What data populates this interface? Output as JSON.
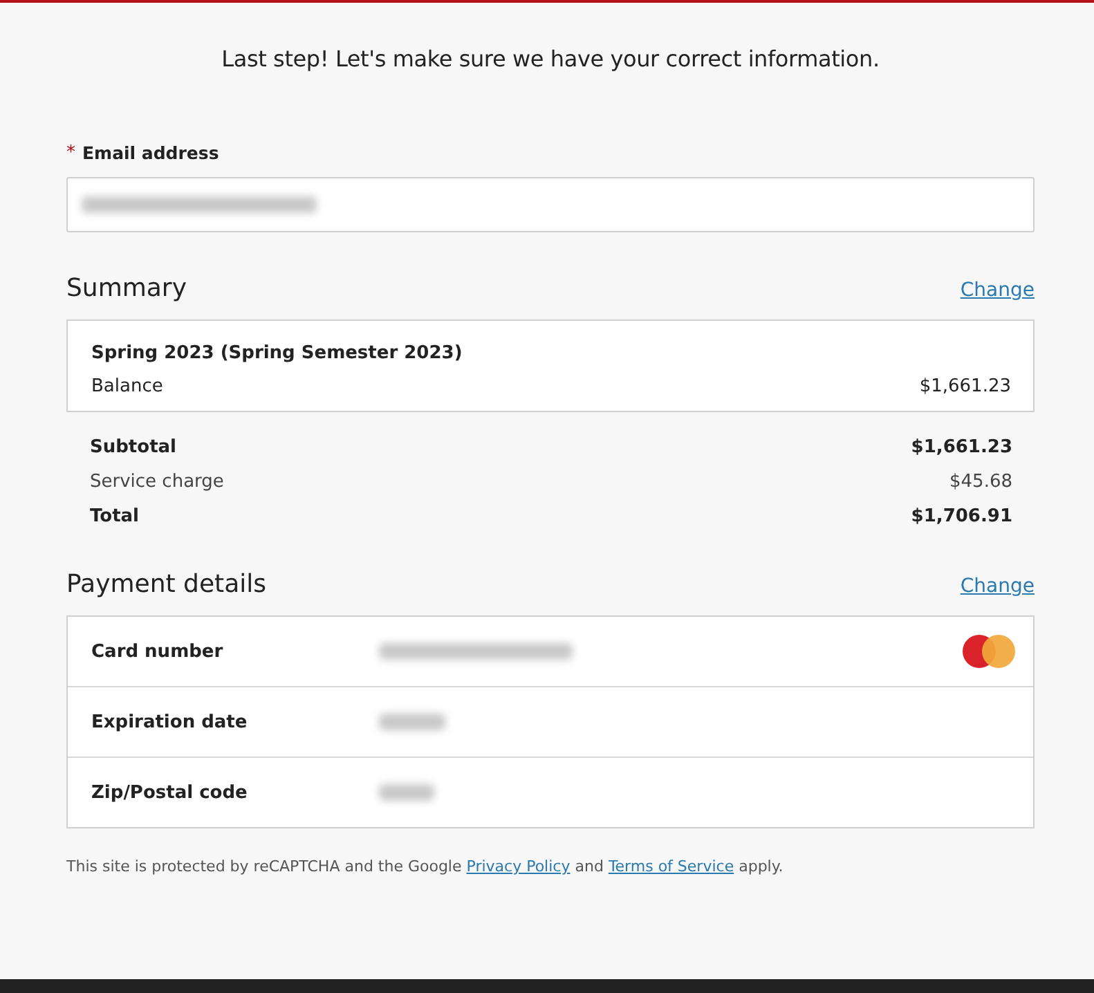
{
  "heading": "Last step! Let's make sure we have your correct information.",
  "email": {
    "label": "Email address",
    "required": true,
    "required_mark": "*",
    "value_blurred": true
  },
  "summary": {
    "title": "Summary",
    "change_link": "Change",
    "term": "Spring 2023 (Spring Semester 2023)",
    "line_label": "Balance",
    "line_amount": "$1,661.23",
    "totals": [
      {
        "label": "Subtotal",
        "amount": "$1,661.23",
        "bold": true
      },
      {
        "label": "Service charge",
        "amount": "$45.68",
        "bold": false
      },
      {
        "label": "Total",
        "amount": "$1,706.91",
        "bold": true
      }
    ]
  },
  "payment": {
    "title": "Payment details",
    "change_link": "Change",
    "rows": [
      {
        "label": "Card number",
        "value_blurred": true,
        "kind": "card"
      },
      {
        "label": "Expiration date",
        "value_blurred": true,
        "kind": "plain"
      },
      {
        "label": "Zip/Postal code",
        "value_blurred": true,
        "kind": "plain"
      }
    ]
  },
  "notice": {
    "before": "This site is protected by reCAPTCHA and the Google ",
    "link1": "Privacy Policy",
    "middle": " and ",
    "link2": "Terms of Service",
    "after": " apply."
  }
}
